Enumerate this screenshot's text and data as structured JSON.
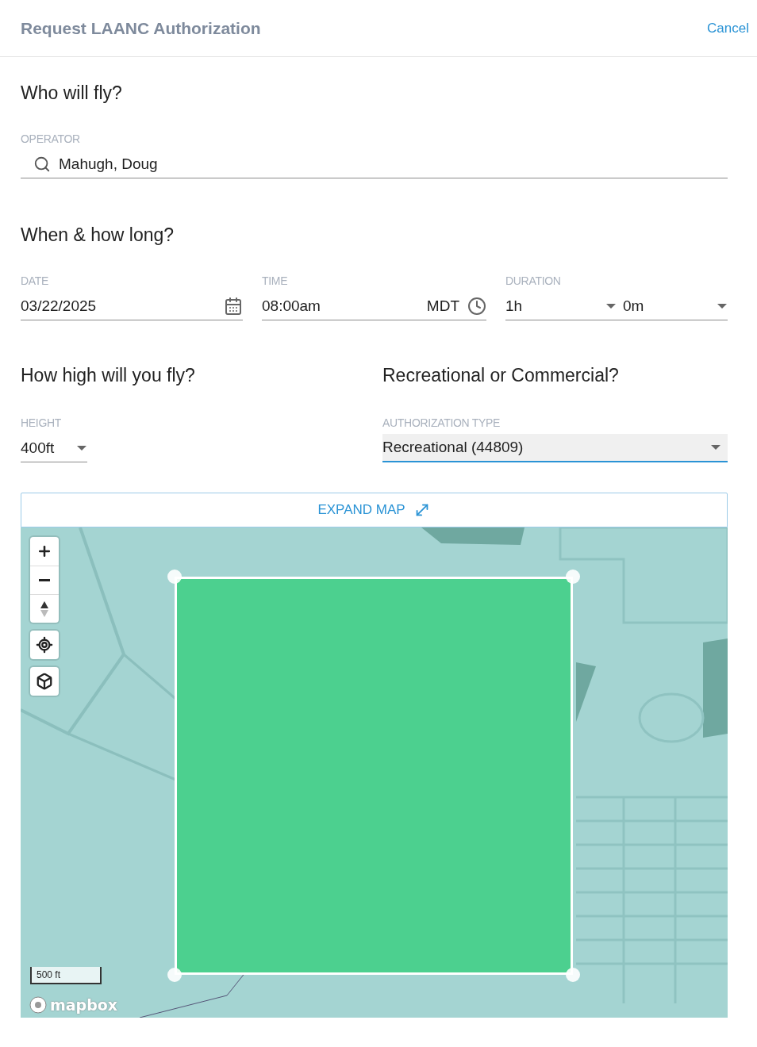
{
  "header": {
    "title": "Request LAANC Authorization",
    "cancel": "Cancel"
  },
  "who": {
    "heading": "Who will fly?",
    "operator": {
      "label": "OPERATOR",
      "value": "Mahugh, Doug"
    }
  },
  "when": {
    "heading": "When & how long?",
    "date": {
      "label": "DATE",
      "value": "03/22/2025"
    },
    "time": {
      "label": "TIME",
      "value": "08:00am",
      "zone": "MDT"
    },
    "duration": {
      "label": "DURATION",
      "hours": "1h",
      "minutes": "0m"
    }
  },
  "height": {
    "heading": "How high will you fly?",
    "label": "HEIGHT",
    "value": "400ft"
  },
  "type": {
    "heading": "Recreational or Commercial?",
    "label": "AUTHORIZATION TYPE",
    "value": "Recreational (44809)",
    "focused": true
  },
  "map": {
    "expand": "EXPAND MAP",
    "scale": "500 ft",
    "logo": "mapbox"
  }
}
